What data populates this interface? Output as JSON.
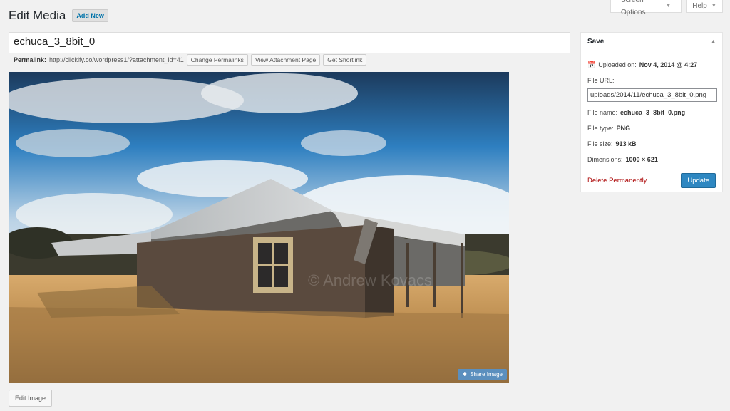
{
  "top_tabs": {
    "screen_options": "Screen Options",
    "help": "Help"
  },
  "header": {
    "title": "Edit Media",
    "add_new": "Add New"
  },
  "title_field": {
    "value": "echuca_3_8bit_0"
  },
  "permalink": {
    "label": "Permalink:",
    "url": "http://clickify.co/wordpress1/?attachment_id=41",
    "buttons": [
      "Change Permalinks",
      "View Attachment Page",
      "Get Shortlink"
    ]
  },
  "image": {
    "watermark": "© Andrew Kovacs",
    "share_label": "Share Image"
  },
  "edit_image_label": "Edit Image",
  "save_box": {
    "title": "Save",
    "uploaded_label": "Uploaded on:",
    "uploaded_value": "Nov 4, 2014 @ 4:27",
    "file_url_label": "File URL:",
    "file_url_value": "uploads/2014/11/echuca_3_8bit_0.png",
    "file_name_label": "File name:",
    "file_name_value": "echuca_3_8bit_0.png",
    "file_type_label": "File type:",
    "file_type_value": "PNG",
    "file_size_label": "File size:",
    "file_size_value": "913 kB",
    "dimensions_label": "Dimensions:",
    "dimensions_value": "1000 × 621",
    "delete_label": "Delete Permanently",
    "update_label": "Update"
  },
  "colors": {
    "accent": "#2e87c1",
    "link": "#0073aa",
    "danger": "#aa0000"
  }
}
